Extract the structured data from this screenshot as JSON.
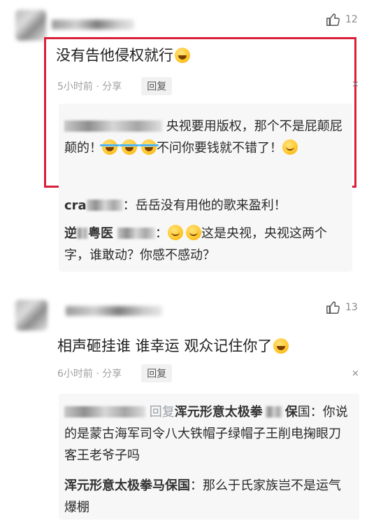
{
  "comment1": {
    "likes": "12",
    "text": "没有告他侵权就行",
    "time_share": "5小时前 · 分享",
    "reply_label": "回复",
    "close": "×",
    "replies": [
      {
        "text": "央视要用版权，那个不是屁颠屁颠的！",
        "text2": "不问你要钱就不错了！"
      },
      {
        "name": "cra",
        "text": "：岳岳没有用他的歌来盈利！"
      },
      {
        "name": "逆",
        "name2": "粤医",
        "text": "：",
        "text2": "这是央视，央视这两个字，谁敢动？你感不感动？"
      }
    ]
  },
  "comment2": {
    "likes": "13",
    "text": "相声砸挂谁 谁幸运 观众记住你了",
    "time_share": "6小时前 · 分享",
    "reply_label": "回复",
    "close": "×",
    "replies": [
      {
        "reply_word": "回复",
        "name": "浑元形意太极拳",
        "name_end": "保",
        "text": "国：你说的是蒙古海军司令八大铁帽子绿帽子王削电掬眼刀客王老爷子吗"
      },
      {
        "name": "浑元形意太极拳马保国",
        "text": "：那么于氏家族岂不是运气爆棚"
      }
    ]
  },
  "colors": {
    "highlight_frame": "#d8203a",
    "reply_bg": "#f7f7f7"
  },
  "icons": [
    "thumbs-up-icon",
    "grinning-emoji",
    "tears-of-joy-emoji",
    "smiling-emoji",
    "close-icon"
  ]
}
